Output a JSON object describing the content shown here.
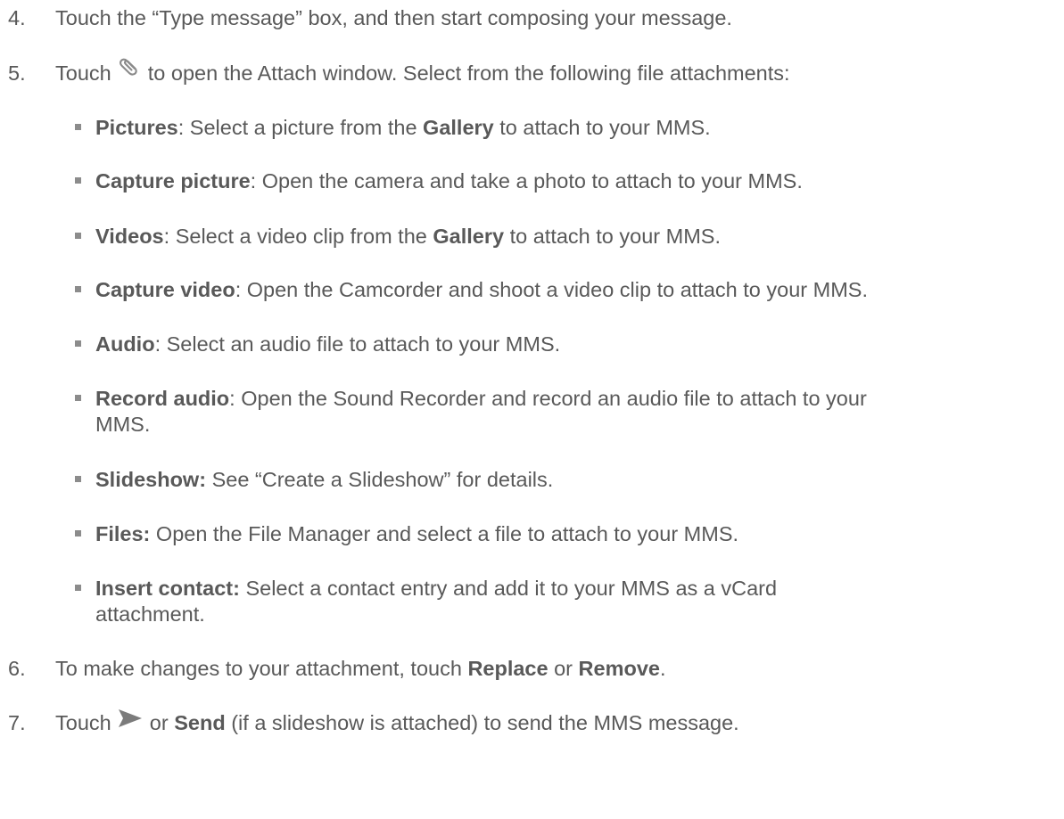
{
  "steps": [
    {
      "num": "4.",
      "text": "Touch the “Type message” box, and then start composing your message."
    },
    {
      "num": "5.",
      "pre": "Touch",
      "icon": "paperclip-icon",
      "post": "to open the Attach window. Select from the following file attachments:"
    },
    {
      "num": "6.",
      "pre": "To make changes to your attachment, touch ",
      "bold1": "Replace",
      "mid": " or ",
      "bold2": "Remove",
      "post": "."
    },
    {
      "num": "7.",
      "pre": "Touch",
      "icon": "send-arrow-icon",
      "mid": "or ",
      "bold": "Send",
      "post": " (if a slideshow is attached) to send the MMS message."
    }
  ],
  "attachments": [
    {
      "label": "Pictures",
      "text1": ": Select a picture from the ",
      "bold2": "Gallery",
      "text2": " to attach to your MMS."
    },
    {
      "label": "Capture picture",
      "text1": ": Open the camera and take a photo to attach to your MMS."
    },
    {
      "label": "Videos",
      "text1": ": Select a video clip from the ",
      "bold2": "Gallery",
      "text2": " to attach to your MMS."
    },
    {
      "label": "Capture video",
      "text1": ": Open the Camcorder and shoot a video clip to attach to your MMS."
    },
    {
      "label": "Audio",
      "text1": ": Select an audio file to attach to your MMS."
    },
    {
      "label": "Record audio",
      "text1": ": Open the Sound Recorder and record an audio file to attach to your",
      "cont": "MMS."
    },
    {
      "label": "Slideshow:",
      "text1": " See “Create a Slideshow” for details."
    },
    {
      "label": "Files:",
      "text1": " Open the File Manager and select a file to attach to your MMS."
    },
    {
      "label": "Insert contact:",
      "text1": " Select a contact entry and add it to your MMS as a vCard",
      "cont": "attachment."
    }
  ],
  "colors": {
    "text": "#595959",
    "bullet": "#8c8c8c",
    "send_icon": "#7b7b7b"
  }
}
